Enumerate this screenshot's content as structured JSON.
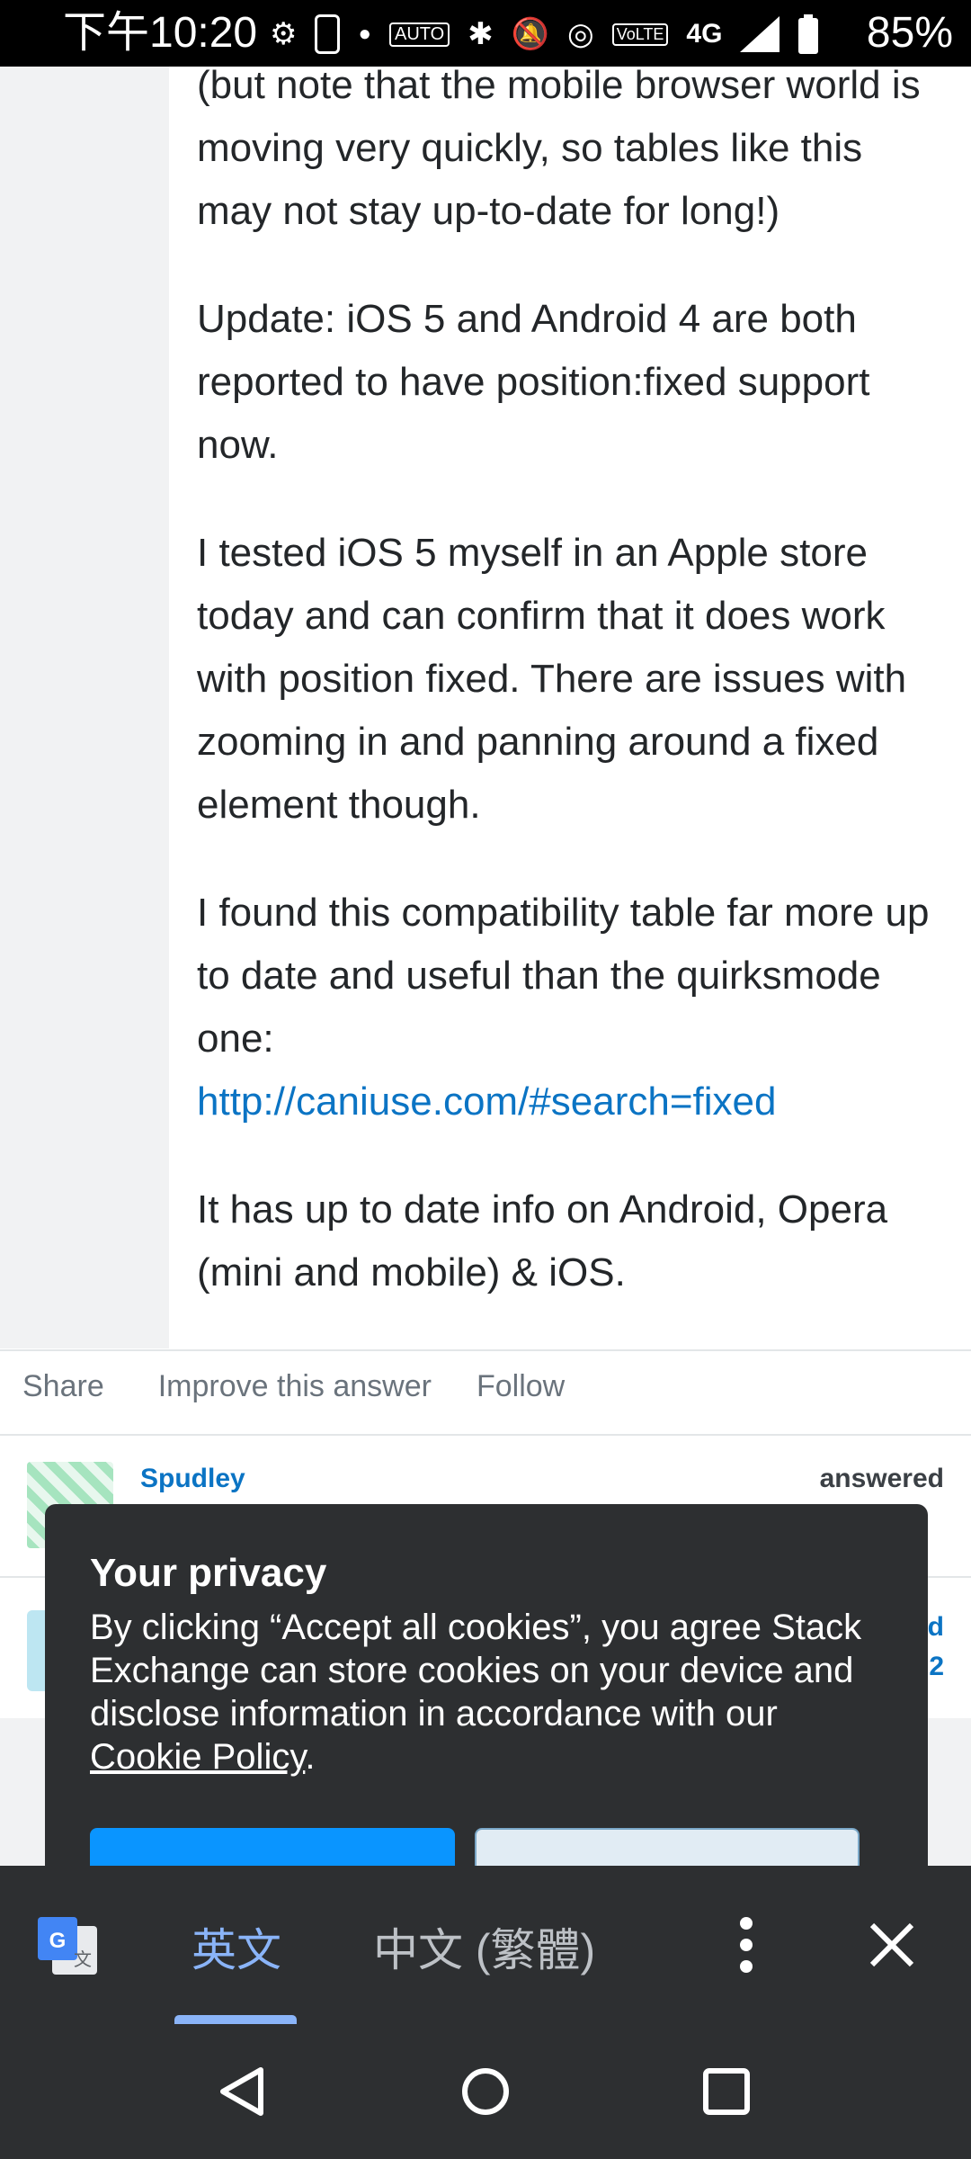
{
  "status_bar": {
    "time": "下午10:20",
    "battery_percent": "85%",
    "icons": [
      "gear-icon",
      "nba-icon",
      "dot-icon",
      "auto-hz-icon",
      "bluetooth-icon",
      "mute-icon",
      "hotspot-icon",
      "volte-icon",
      "4g-icon",
      "signal-icon",
      "battery-icon"
    ],
    "network_label": "4G"
  },
  "answer": {
    "paragraphs": [
      "(but note that the mobile browser world is moving very quickly, so tables like this may not stay up-to-date for long!)",
      "Update: iOS 5 and Android 4 are both reported to have position:fixed support now.",
      "I tested iOS 5 myself in an Apple store today and can confirm that it does work with position fixed. There are issues with zooming in and panning around a fixed element though.",
      "I found this compatibility table far more up to date and useful than the quirksmode one:",
      "It has up to date info on Android, Opera (mini and mobile) & iOS."
    ],
    "link": "http://caniuse.com/#search=fixed"
  },
  "actions": {
    "share": "Share",
    "improve": "Improve this answer",
    "follow": "Follow"
  },
  "user_card": {
    "name": "Spudley",
    "answered_label": "answered",
    "edge_text_1": "d",
    "edge_text_2": "2"
  },
  "cookie_dialog": {
    "title": "Your privacy",
    "body": "By clicking “Accept all cookies”, you agree Stack Exchange can store cookies on your device and disclose information in accordance with our ",
    "policy_link": "Cookie Policy",
    "policy_suffix": "."
  },
  "translate_bar": {
    "source_lang": "英文",
    "target_lang": "中文 (繁體)",
    "colors": {
      "active": "#8ab4f8",
      "inactive": "#bdc1c6"
    }
  },
  "colors": {
    "link": "#0b74c4",
    "primary_button": "#0a95ff",
    "dialog_bg": "#2d2f31"
  }
}
